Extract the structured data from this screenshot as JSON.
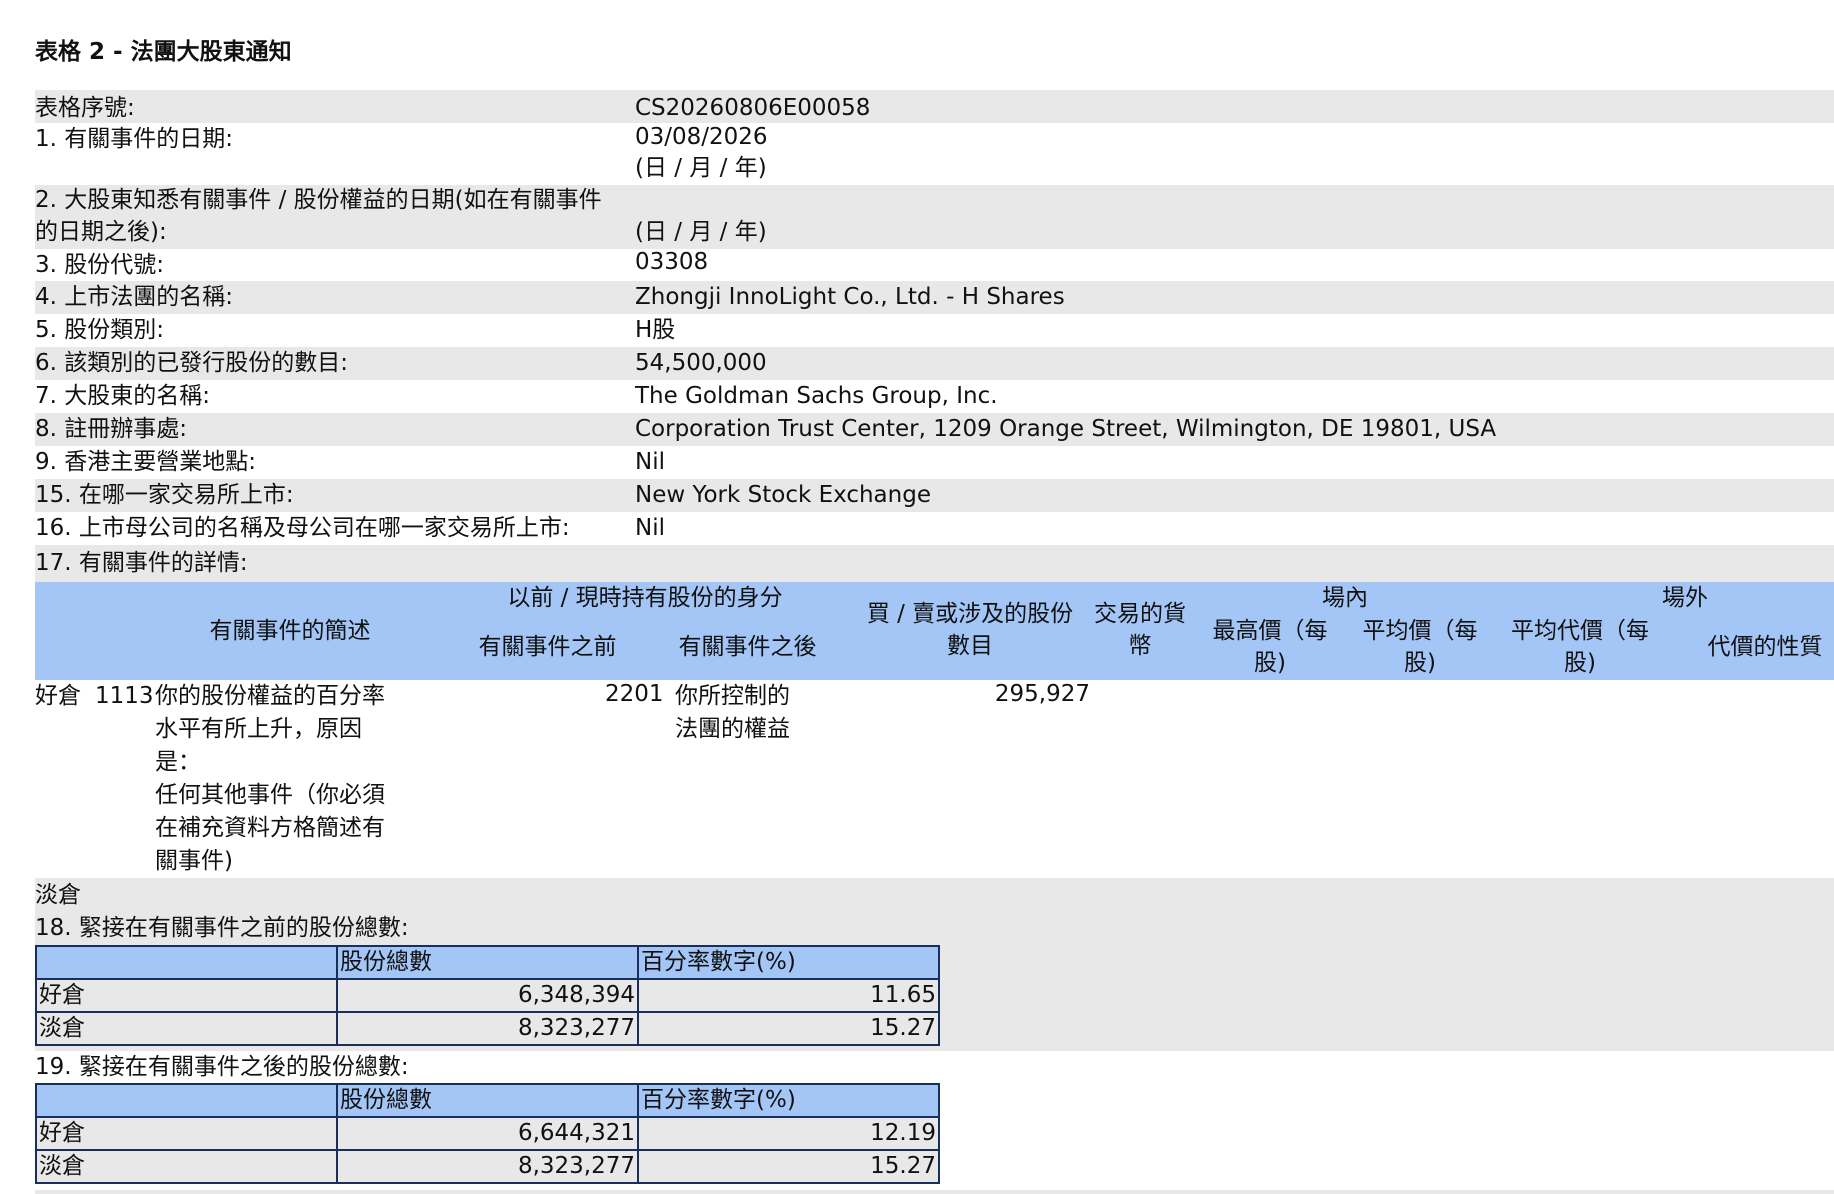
{
  "form_title": "表格 2 - 法團大股東通知",
  "fields": {
    "serial": {
      "label": "表格序號:",
      "value": "CS20260806E00058"
    },
    "f1": {
      "label": "1. 有關事件的日期:",
      "value": "03/08/2026",
      "note": "(日 / 月 / 年)"
    },
    "f2": {
      "label_line1": "2. 大股東知悉有關事件 / 股份權益的日期(如在有關事件",
      "label_line2": "的日期之後):",
      "note": "(日 / 月 / 年)"
    },
    "f3": {
      "label": "3. 股份代號:",
      "value": "03308"
    },
    "f4": {
      "label": "4. 上市法團的名稱:",
      "value": "Zhongji InnoLight Co., Ltd. - H Shares"
    },
    "f5": {
      "label": "5. 股份類別:",
      "value": "H股"
    },
    "f6": {
      "label": "6. 該類別的已發行股份的數目:",
      "value": "54,500,000"
    },
    "f7": {
      "label": "7. 大股東的名稱:",
      "value": "The Goldman Sachs Group, Inc."
    },
    "f8": {
      "label": "8. 註冊辦事處:",
      "value": "Corporation Trust Center, 1209 Orange Street, Wilmington, DE 19801, USA"
    },
    "f9": {
      "label": "9. 香港主要營業地點:",
      "value": "Nil"
    },
    "f15": {
      "label": "15. 在哪一家交易所上市:",
      "value": "New York Stock Exchange"
    },
    "f16": {
      "label": "16. 上市母公司的名稱及母公司在哪一家交易所上市:",
      "value": "Nil"
    },
    "f17": {
      "label": "17. 有關事件的詳情:"
    }
  },
  "event_table": {
    "headers": {
      "description": "有關事件的簡述",
      "capacity_group": "以前 / 現時持有股份的身分",
      "before": "有關事件之前",
      "after": "有關事件之後",
      "shares_line1": "買 / 賣或涉及的股份",
      "shares_line2": "數目",
      "currency_line1": "交易的貨",
      "currency_line2": "幣",
      "on_exchange": "場內",
      "off_exchange": "場外",
      "highest_line1": "最高價（每",
      "highest_line2": "股)",
      "average_line1": "平均價（每",
      "average_line2": "股)",
      "avg_consid_line1": "平均代價（每",
      "avg_consid_line2": "股)",
      "consid_nature": "代價的性質"
    },
    "row": {
      "position": "好倉",
      "code": "1113",
      "desc_lines": [
        "你的股份權益的百分率",
        "水平有所上升，原因",
        "是：",
        "任何其他事件（你必須",
        "在補充資料方格簡述有",
        "關事件)"
      ],
      "after_code": "2201",
      "after_lines": [
        "你所控制的",
        "法團的權益"
      ],
      "shares": "295,927"
    },
    "short_label": "淡倉"
  },
  "f18": {
    "label": "18. 緊接在有關事件之前的股份總數:",
    "col_total": "股份總數",
    "col_pct": "百分率數字(%)",
    "rows": [
      {
        "pos": "好倉",
        "total": "6,348,394",
        "pct": "11.65"
      },
      {
        "pos": "淡倉",
        "total": "8,323,277",
        "pct": "15.27"
      }
    ]
  },
  "f19": {
    "label": "19. 緊接在有關事件之後的股份總數:",
    "col_total": "股份總數",
    "col_pct": "百分率數字(%)",
    "rows": [
      {
        "pos": "好倉",
        "total": "6,644,321",
        "pct": "12.19"
      },
      {
        "pos": "淡倉",
        "total": "8,323,277",
        "pct": "15.27"
      }
    ]
  }
}
